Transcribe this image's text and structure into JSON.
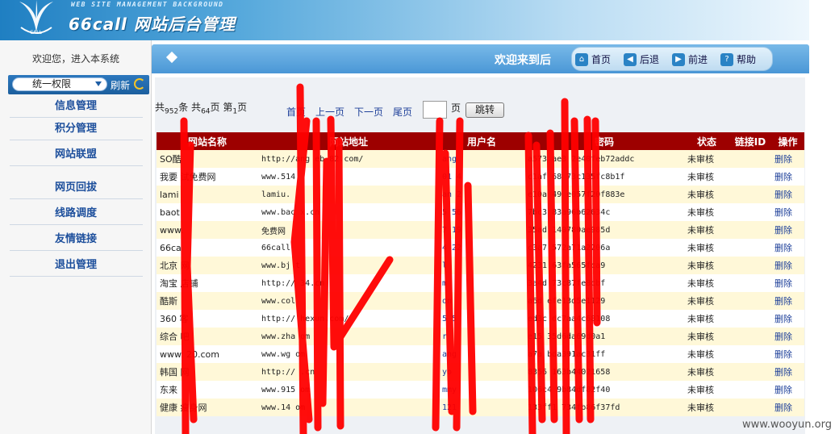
{
  "header": {
    "subtitle": "WEB SITE MANAGEMENT BACKGROUND",
    "title": "66call 网站后台管理",
    "logo_text": "CALL"
  },
  "sidebar": {
    "welcome": "欢迎您，进入本系统",
    "perm_select": "统一权限",
    "refresh": "刷新",
    "items": [
      {
        "label": "信息管理"
      },
      {
        "label": "积分管理"
      },
      {
        "label": "网站联盟"
      },
      {
        "label": "网页回拔"
      },
      {
        "label": "线路调度"
      },
      {
        "label": "友情链接"
      },
      {
        "label": "退出管理"
      }
    ]
  },
  "titlebar": {
    "welcome": "欢迎来到后",
    "buttons": [
      "首页",
      "后退",
      "前进",
      "帮助"
    ]
  },
  "pager": {
    "total_prefix": "共",
    "total_records": "952",
    "records_unit": "条",
    "pages_prefix": "共",
    "total_pages": "64",
    "pages_unit": "页",
    "current_prefix": "第",
    "current_page": "1",
    "current_unit": "页",
    "first": "首页",
    "prev": "上一页",
    "next": "下一页",
    "last": "尾页",
    "page_suffix": "页",
    "go": "跳转"
  },
  "table": {
    "headers": [
      "网站名称",
      "网站地址",
      "用户名",
      "密码",
      "状态",
      "链接ID",
      "操作"
    ],
    "rows": [
      {
        "name": "SO酷",
        "url": "http://ang   eb-82.com/",
        "user": "ang",
        "pwd": "a573   ae3   2e40feb72addc",
        "status": "未审核",
        "op": "删除"
      },
      {
        "name": "我要   试免费网",
        "url": "www.514",
        "user": "01   4",
        "pwd": "c1af   68   73c135fc8b1f",
        "status": "未审核",
        "op": "删除"
      },
      {
        "name": "lami",
        "url": "lamiu.",
        "user": "an   2",
        "pwd": "e10a   49   e057f20f883e",
        "status": "未审核",
        "op": "删除"
      },
      {
        "name": "baot",
        "url": "www.bac   x.cn",
        "user": "5   56",
        "pwd": "7bc3   83a96b62634c",
        "status": "未审核",
        "op": "删除"
      },
      {
        "name": "www.",
        "url": "免费网",
        "user": "7   19",
        "pwd": "35ad   140780ae985d",
        "status": "未审核",
        "op": "删除"
      },
      {
        "name": "66ca",
        "url": "66call",
        "user": "4   22",
        "pwd": "c3a7   572a71a2206a",
        "status": "未审核",
        "op": "删除"
      },
      {
        "name": "北京   网",
        "url": "www.bj   t",
        "user": "l",
        "pwd": "4231   63fa565fca9",
        "status": "未审核",
        "op": "删除"
      },
      {
        "name": "淘宝   店铺",
        "url": "http://   34.cn",
        "user": "m",
        "pwd": "3a4d   73c87fe8cbf",
        "status": "未审核",
        "op": "删除"
      },
      {
        "name": "酷斯",
        "url": "www.col",
        "user": "on",
        "pwd": "a6d   efe13d5e1129",
        "status": "未审核",
        "op": "删除"
      },
      {
        "name": "360   客",
        "url": "http://   hexun.com/",
        "user": "5   5",
        "pwd": "ed3c   dc7aa4c68108",
        "status": "未审核",
        "op": "删除"
      },
      {
        "name": "综合   吧",
        "url": "www.zha   om",
        "user": "r",
        "pwd": "e15   35d6da69d0a1",
        "status": "未审核",
        "op": "删除"
      },
      {
        "name": "www.   20.com",
        "url": "www.wg   om",
        "user": "ang",
        "pwd": "a7a   bda391ac31ff",
        "status": "未审核",
        "op": "删除"
      },
      {
        "name": "韩国   网",
        "url": "http://   .cn",
        "user": "yo",
        "pwd": "8356   163b44021658",
        "status": "未审核",
        "op": "删除"
      },
      {
        "name": "东来   ",
        "url": "www.915   om",
        "user": "mmy",
        "pwd": "106c4   9b84df82f40",
        "status": "未审核",
        "op": "删除"
      },
      {
        "name": "健康   瘦身网",
        "url": "www.14   om",
        "user": "121",
        "pwd": "133ff1   734fb86f37fd",
        "status": "未审核",
        "op": "删除"
      }
    ]
  },
  "watermark": "www.wooyun.org",
  "colors": {
    "header_red": "#9d0000",
    "link_blue": "#1d3f99",
    "row_yellow": "#fff8d8",
    "redaction": "#ff0000"
  }
}
